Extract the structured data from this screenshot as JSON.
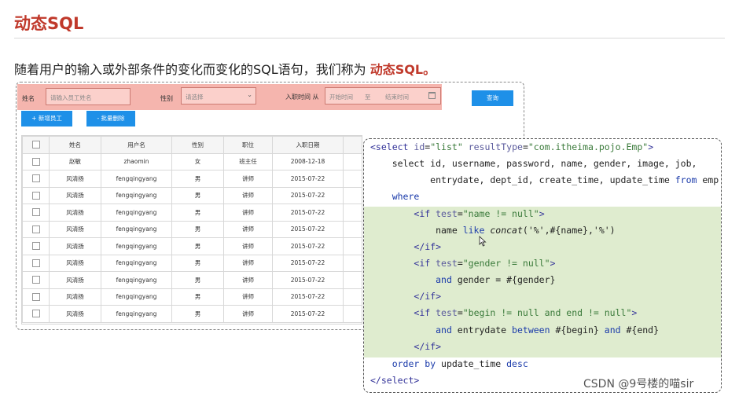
{
  "heading": "动态SQL",
  "subtitle": {
    "text": "随着用户的输入或外部条件的变化而变化的SQL语句，我们称为 ",
    "emphasis": "动态SQL。"
  },
  "filter": {
    "name_label": "姓名",
    "name_placeholder": "请输入员工姓名",
    "gender_label": "性别",
    "gender_placeholder": "请选择",
    "date_label": "入职时间",
    "date_label_tail": "从",
    "date_start": "开始时间",
    "date_sep": "至",
    "date_end": "结束时间",
    "search_button": "查询"
  },
  "actions": {
    "add_button": "+ 新增员工",
    "batch_delete_button": "- 批量删除"
  },
  "table": {
    "columns": [
      "姓名",
      "用户名",
      "性别",
      "职位",
      "入职日期"
    ],
    "rows": [
      [
        "赵敏",
        "zhaomin",
        "女",
        "班主任",
        "2008-12-18"
      ],
      [
        "风清扬",
        "fengqingyang",
        "男",
        "讲师",
        "2015-07-22"
      ],
      [
        "风清扬",
        "fengqingyang",
        "男",
        "讲师",
        "2015-07-22"
      ],
      [
        "风清扬",
        "fengqingyang",
        "男",
        "讲师",
        "2015-07-22"
      ],
      [
        "风清扬",
        "fengqingyang",
        "男",
        "讲师",
        "2015-07-22"
      ],
      [
        "风清扬",
        "fengqingyang",
        "男",
        "讲师",
        "2015-07-22"
      ],
      [
        "风清扬",
        "fengqingyang",
        "男",
        "讲师",
        "2015-07-22"
      ],
      [
        "风清扬",
        "fengqingyang",
        "男",
        "讲师",
        "2015-07-22"
      ],
      [
        "风清扬",
        "fengqingyang",
        "男",
        "讲师",
        "2015-07-22"
      ],
      [
        "风清扬",
        "fengqingyang",
        "男",
        "讲师",
        "2015-07-22"
      ]
    ]
  },
  "code": {
    "lines": [
      "<select id=\"list\" resultType=\"com.itheima.pojo.Emp\">",
      "    select id, username, password, name, gender, image, job,",
      "           entrydate, dept_id, create_time, update_time from emp",
      "    where",
      "        <if test=\"name != null\">",
      "            name like concat('%',#{name},'%')",
      "        </if>",
      "        <if test=\"gender != null\">",
      "            and gender = #{gender}",
      "        </if>",
      "        <if test=\"begin != null and end != null\">",
      "            and entrydate between #{begin} and #{end}",
      "        </if>",
      "    order by update_time desc",
      "</select>"
    ]
  },
  "watermark": "CSDN @9号楼的喵sir",
  "colors": {
    "accent": "#c0392b",
    "filter_bg": "#f5b5ae",
    "button_blue": "#1e90e8",
    "code_highlight": "#dfeccf"
  }
}
